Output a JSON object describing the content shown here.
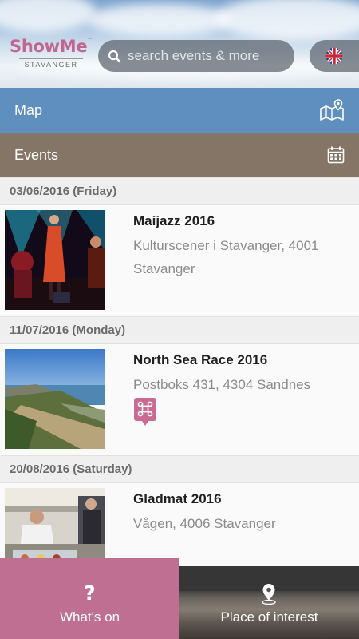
{
  "header": {
    "logo": {
      "name": "ShowMe",
      "tm": "™",
      "sub": "STAVANGER"
    },
    "search": {
      "placeholder": "search events & more",
      "icon": "search-icon"
    },
    "language": {
      "icon": "uk-flag-icon"
    }
  },
  "nav": {
    "map": {
      "label": "Map",
      "icon": "map-pin-icon",
      "color": "#5e8fbe"
    },
    "events": {
      "label": "Events",
      "icon": "calendar-icon",
      "color": "#857567"
    }
  },
  "events": [
    {
      "date": "03/06/2016 (Friday)",
      "title": "Maijazz 2016",
      "address": "Kulturscener i Stavanger, 4001 Stavanger",
      "image": "concert-photo"
    },
    {
      "date": "11/07/2016 (Monday)",
      "title": "North Sea Race 2016",
      "address": "Postboks 431, 4304 Sandnes",
      "image": "coast-photo",
      "badge": "command-badge-icon"
    },
    {
      "date": "20/08/2016 (Saturday)",
      "title": "Gladmat 2016",
      "address": "Vågen, 4006 Stavanger",
      "image": "food-stall-photo"
    }
  ],
  "bottom_tabs": {
    "whats_on": {
      "label": "What's on",
      "icon": "question-icon",
      "color": "#bf6f92"
    },
    "place_of_interest": {
      "label": "Place of interest",
      "icon": "location-pin-icon"
    }
  }
}
